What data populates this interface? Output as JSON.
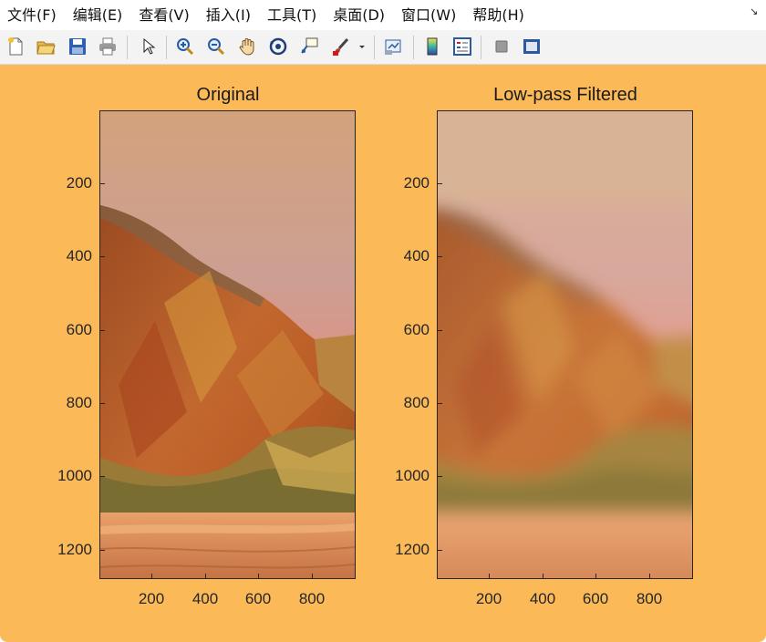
{
  "menu": {
    "items": [
      "文件(F)",
      "编辑(E)",
      "查看(V)",
      "插入(I)",
      "工具(T)",
      "桌面(D)",
      "窗口(W)",
      "帮助(H)"
    ]
  },
  "toolbar": {
    "buttons": [
      "new-figure",
      "open-file",
      "save",
      "print",
      "edit-plot",
      "zoom-in",
      "zoom-out",
      "pan",
      "rotate-3d",
      "data-cursor",
      "brush",
      "link-plot",
      "insert-colorbar",
      "insert-legend",
      "hide-plot-tools",
      "show-plot-tools"
    ]
  },
  "figure": {
    "background": "#fbb957",
    "axes": [
      {
        "title": "Original",
        "yticks": [
          "200",
          "400",
          "600",
          "800",
          "1000",
          "1200"
        ],
        "xticks": [
          "200",
          "400",
          "600",
          "800"
        ]
      },
      {
        "title": "Low-pass Filtered",
        "yticks": [
          "200",
          "400",
          "600",
          "800",
          "1000",
          "1200"
        ],
        "xticks": [
          "200",
          "400",
          "600",
          "800"
        ]
      }
    ]
  }
}
